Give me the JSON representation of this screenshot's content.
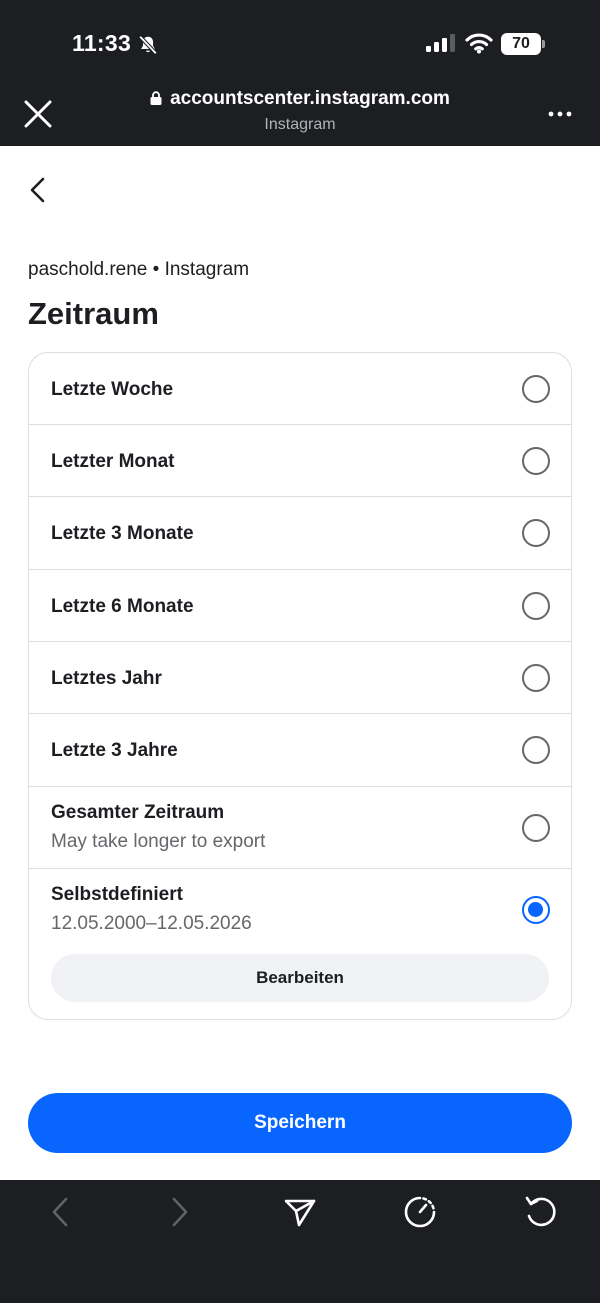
{
  "status_bar": {
    "time": "11:33",
    "battery": "70",
    "icons": [
      "bell-slash-icon",
      "signal-icon",
      "wifi-icon",
      "battery-icon"
    ]
  },
  "browser": {
    "url": "accountscenter.instagram.com",
    "site_name": "Instagram",
    "icons": [
      "close-icon",
      "lock-icon",
      "more-icon"
    ]
  },
  "page": {
    "breadcrumb": "paschold.rene • Instagram",
    "title": "Zeitraum"
  },
  "options": [
    {
      "label": "Letzte Woche",
      "selected": false
    },
    {
      "label": "Letzter Monat",
      "selected": false
    },
    {
      "label": "Letzte 3 Monate",
      "selected": false
    },
    {
      "label": "Letzte 6 Monate",
      "selected": false
    },
    {
      "label": "Letztes Jahr",
      "selected": false
    },
    {
      "label": "Letzte 3 Jahre",
      "selected": false
    },
    {
      "label": "Gesamter Zeitraum",
      "sublabel": "May take longer to export",
      "selected": false
    },
    {
      "label": "Selbstdefiniert",
      "sublabel": "12.05.2000–12.05.2026",
      "selected": true
    }
  ],
  "edit_button": "Bearbeiten",
  "save_button": "Speichern",
  "colors": {
    "accent": "#0866ff",
    "chrome": "#1c1e21",
    "divider": "#dadde1",
    "secondary_text": "#65676b"
  },
  "toolbar": {
    "icons": [
      "back-arrow-icon",
      "forward-arrow-icon",
      "send-icon",
      "timer-icon",
      "reload-icon"
    ]
  }
}
